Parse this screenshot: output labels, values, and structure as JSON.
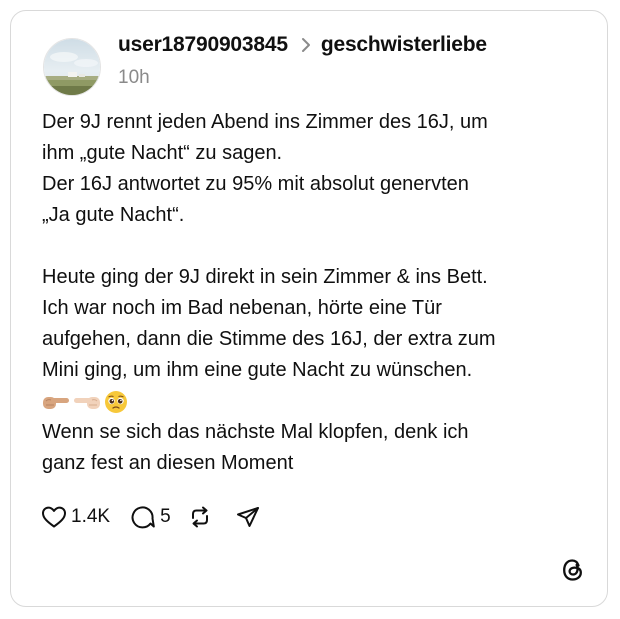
{
  "post": {
    "username": "user18790903845",
    "community": "geschwisterliebe",
    "time": "10h",
    "paragraph1": [
      "Der 9J rennt jeden Abend ins Zimmer des 16J, um",
      "ihm „gute Nacht“ zu sagen.",
      "Der 16J antwortet zu 95% mit absolut genervten",
      "„Ja gute Nacht“."
    ],
    "paragraph2": [
      "Heute ging der 9J direkt in sein Zimmer & ins Bett.",
      "Ich war noch im Bad nebenan, hörte eine Tür",
      "aufgehen, dann die Stimme des 16J, der extra zum",
      "Mini ging, um ihm eine gute Nacht zu wünschen."
    ],
    "emojis": [
      "pointing-right-icon",
      "pointing-left-icon",
      "pleading-face-icon"
    ],
    "paragraph3": [
      "Wenn se sich das nächste Mal klopfen, denk ich",
      "ganz fest an diesen Moment"
    ]
  },
  "actions": {
    "likes": "1.4K",
    "replies": "5",
    "icons": [
      "heart-icon",
      "comment-icon",
      "repost-icon",
      "share-icon"
    ]
  },
  "branding": {
    "logo": "threads-logo-icon"
  },
  "colors": {
    "text": "#101010",
    "muted": "#8a8a8a",
    "border": "#d9d9d9",
    "background": "#ffffff"
  }
}
